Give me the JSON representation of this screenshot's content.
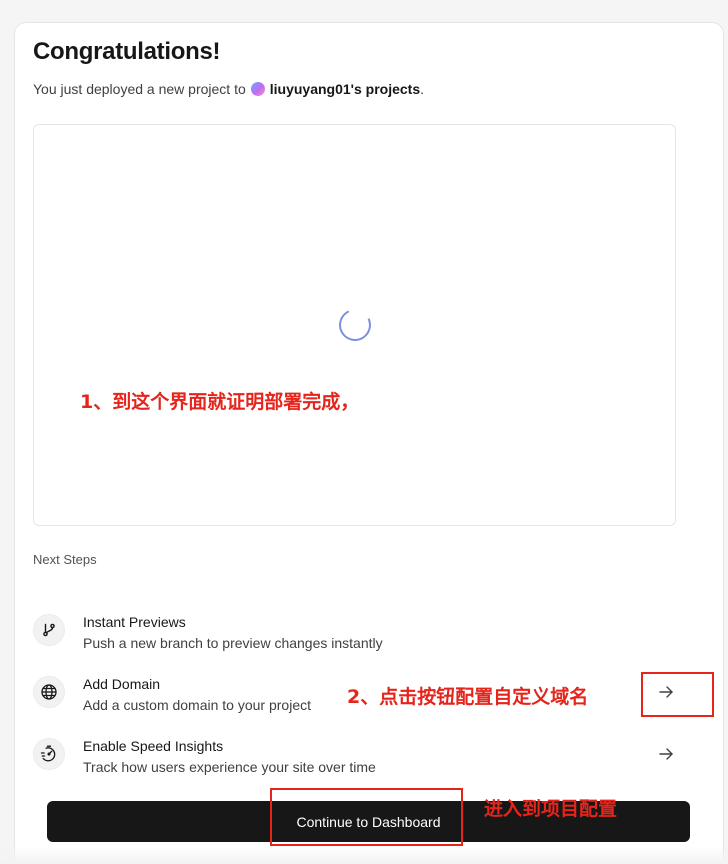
{
  "header": {
    "title": "Congratulations!",
    "subtitle_prefix": "You just deployed a new project to",
    "team_name": "liuyuyang01's projects",
    "subtitle_suffix": "."
  },
  "preview": {
    "loading": true
  },
  "next_steps": {
    "label": "Next Steps",
    "items": [
      {
        "icon": "git-branch-icon",
        "title": "Instant Previews",
        "description": "Push a new branch to preview changes instantly"
      },
      {
        "icon": "globe-icon",
        "title": "Add Domain",
        "description": "Add a custom domain to your project"
      },
      {
        "icon": "speedometer-icon",
        "title": "Enable Speed Insights",
        "description": "Track how users experience your site over time"
      }
    ]
  },
  "cta": {
    "label": "Continue to Dashboard"
  },
  "annotations": {
    "note1": "1、到这个界面就证明部署完成，",
    "note2": "2、点击按钮配置自定义域名",
    "note3": "进入到项目配置"
  },
  "colors": {
    "annotation": "#e5241b",
    "cta_background": "#171717",
    "spinner": "#7b8fe0"
  }
}
